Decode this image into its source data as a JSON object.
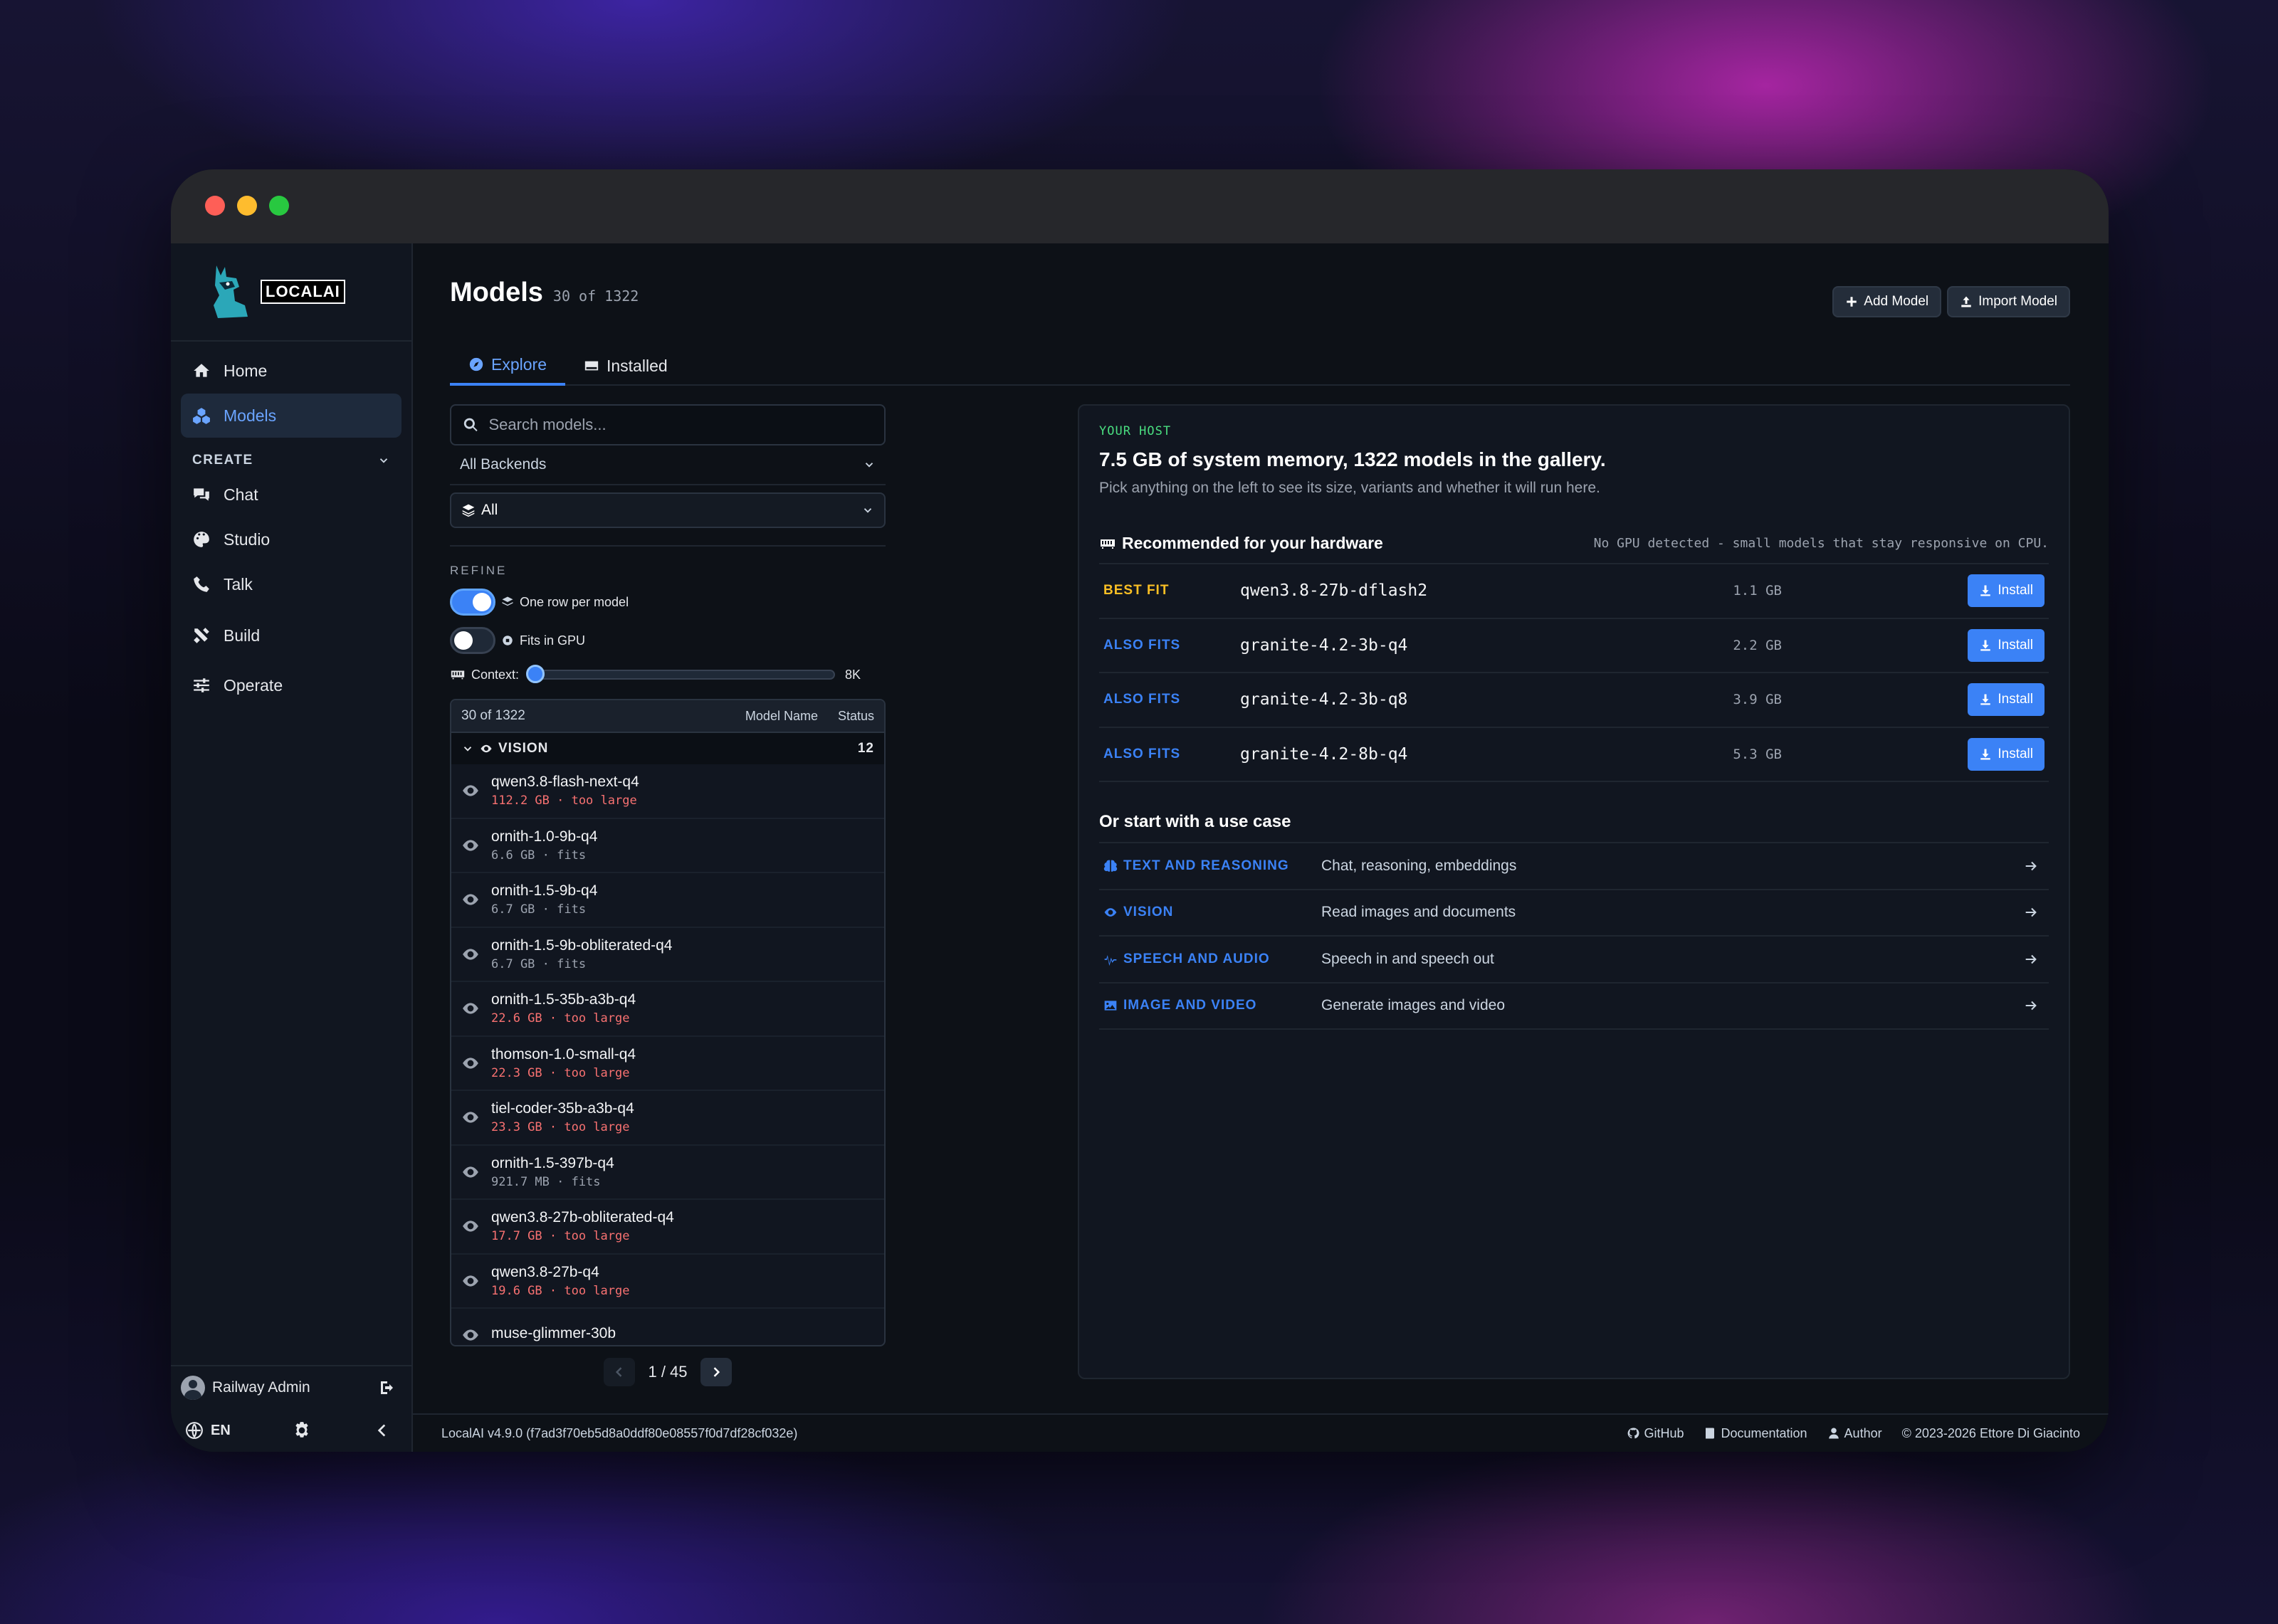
{
  "app": {
    "logo_text": "LOCALAI"
  },
  "sidebar": {
    "items": [
      {
        "label": "Home"
      },
      {
        "label": "Models"
      }
    ],
    "section_create": "CREATE",
    "create_items": [
      {
        "label": "Chat"
      },
      {
        "label": "Studio"
      },
      {
        "label": "Talk"
      }
    ],
    "build": "Build",
    "operate": "Operate",
    "user": "Railway Admin",
    "lang": "EN"
  },
  "header": {
    "title": "Models",
    "count": "30 of 1322",
    "add_model": "Add Model",
    "import_model": "Import Model"
  },
  "tabs": [
    {
      "label": "Explore",
      "active": true
    },
    {
      "label": "Installed",
      "active": false
    }
  ],
  "filters": {
    "search_placeholder": "Search models...",
    "backend": "All Backends",
    "type": "All",
    "refine_label": "REFINE",
    "one_row": "One row per model",
    "one_row_on": true,
    "fits_gpu": "Fits in GPU",
    "fits_gpu_on": false,
    "context_label": "Context:",
    "context_value": "8K",
    "context_fraction": 0
  },
  "list": {
    "count": "30 of 1322",
    "col_name": "Model Name",
    "col_status": "Status",
    "group": "VISION",
    "group_count": "12",
    "models": [
      {
        "name": "qwen3.8-flash-next-q4",
        "meta": "112.2 GB · too large",
        "fits": false
      },
      {
        "name": "ornith-1.0-9b-q4",
        "meta": "6.6 GB · fits",
        "fits": true
      },
      {
        "name": "ornith-1.5-9b-q4",
        "meta": "6.7 GB · fits",
        "fits": true
      },
      {
        "name": "ornith-1.5-9b-obliterated-q4",
        "meta": "6.7 GB · fits",
        "fits": true
      },
      {
        "name": "ornith-1.5-35b-a3b-q4",
        "meta": "22.6 GB · too large",
        "fits": false
      },
      {
        "name": "thomson-1.0-small-q4",
        "meta": "22.3 GB · too large",
        "fits": false
      },
      {
        "name": "tiel-coder-35b-a3b-q4",
        "meta": "23.3 GB · too large",
        "fits": false
      },
      {
        "name": "ornith-1.5-397b-q4",
        "meta": "921.7 MB · fits",
        "fits": true
      },
      {
        "name": "qwen3.8-27b-obliterated-q4",
        "meta": "17.7 GB · too large",
        "fits": false
      },
      {
        "name": "qwen3.8-27b-q4",
        "meta": "19.6 GB · too large",
        "fits": false
      },
      {
        "name": "muse-glimmer-30b",
        "meta": "",
        "fits": true
      }
    ]
  },
  "pager": {
    "text": "1 / 45"
  },
  "host": {
    "label": "YOUR HOST",
    "title": "7.5 GB of system memory, 1322 models in the gallery.",
    "subtitle": "Pick anything on the left to see its size, variants and whether it will run here.",
    "rec_title": "Recommended for your hardware",
    "rec_note": "No GPU detected - small models that stay responsive on CPU.",
    "install_label": "Install",
    "recommendations": [
      {
        "tag": "BEST FIT",
        "kind": "best",
        "name": "qwen3.8-27b-dflash2",
        "size": "1.1 GB"
      },
      {
        "tag": "ALSO FITS",
        "kind": "also",
        "name": "granite-4.2-3b-q4",
        "size": "2.2 GB"
      },
      {
        "tag": "ALSO FITS",
        "kind": "also",
        "name": "granite-4.2-3b-q8",
        "size": "3.9 GB"
      },
      {
        "tag": "ALSO FITS",
        "kind": "also",
        "name": "granite-4.2-8b-q4",
        "size": "5.3 GB"
      }
    ],
    "use_case_title": "Or start with a use case",
    "use_cases": [
      {
        "tag": "TEXT AND REASONING",
        "desc": "Chat, reasoning, embeddings",
        "icon": "brain-icon"
      },
      {
        "tag": "VISION",
        "desc": "Read images and documents",
        "icon": "eye-icon"
      },
      {
        "tag": "SPEECH AND AUDIO",
        "desc": "Speech in and speech out",
        "icon": "waveform-icon"
      },
      {
        "tag": "IMAGE AND VIDEO",
        "desc": "Generate images and video",
        "icon": "image-icon"
      }
    ]
  },
  "footer": {
    "version": "LocalAI v4.9.0 (f7ad3f70eb5d8a0ddf80e08557f0d7df28cf032e)",
    "github": "GitHub",
    "docs": "Documentation",
    "author": "Author",
    "copyright": "© 2023-2026 Ettore Di Giacinto"
  },
  "colors": {
    "accent": "#3b82f6",
    "best_fit": "#fbbf24",
    "too_large": "#f87171",
    "host_label": "#4ade80"
  }
}
